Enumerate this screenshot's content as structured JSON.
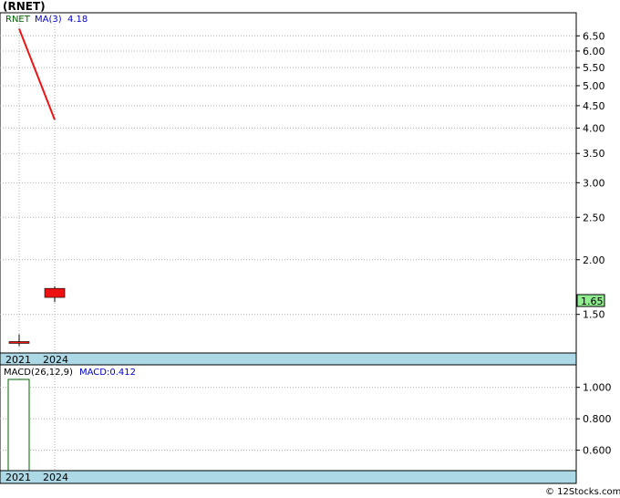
{
  "page_title": "(RNET)",
  "credit": "© 12Stocks.com",
  "chart_data": [
    {
      "type": "candlestick",
      "legend": {
        "ticker": "RNET",
        "ma_label": "MA(3)",
        "ma_value": "4.18"
      },
      "yscale": "log",
      "ylim": [
        1.23,
        7.2
      ],
      "yticks": [
        "6.50",
        "6.00",
        "5.50",
        "5.00",
        "4.50",
        "4.00",
        "3.50",
        "3.00",
        "2.50",
        "2.00",
        "1.50"
      ],
      "categories": [
        "2021",
        "2024"
      ],
      "candles": [
        {
          "x": "2021",
          "open": 1.3,
          "close": 1.3,
          "high": 1.35,
          "low": 1.27
        },
        {
          "x": "2024",
          "open": 1.72,
          "close": 1.64,
          "high": 1.74,
          "low": 1.6
        }
      ],
      "ma": {
        "name": "MA(3)",
        "x": [
          "2021",
          "2024"
        ],
        "values": [
          6.75,
          4.18
        ],
        "color": "#ee1111"
      },
      "last_price": "1.65",
      "grid": true
    },
    {
      "type": "bar",
      "legend": {
        "label": "MACD(26,12,9)",
        "value_label": "MACD:0.412"
      },
      "ylim": [
        0.47,
        1.12
      ],
      "yticks": [
        "1.000",
        "0.800",
        "0.600"
      ],
      "categories": [
        "2021",
        "2024"
      ],
      "values": [
        1.12,
        null
      ],
      "grid": true
    }
  ],
  "colors": {
    "up": "#ee1111",
    "axis_band": "#add8e6",
    "grid": "#b0b0b0",
    "ma": "#ee1111",
    "ticker_text": "#006600",
    "legend_text": "#0000cc",
    "price_box": "#90ee90"
  }
}
